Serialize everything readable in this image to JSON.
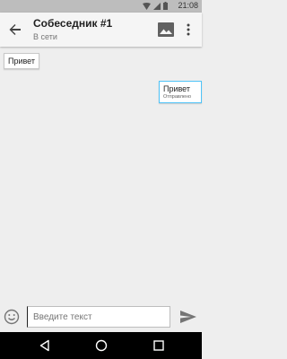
{
  "status_bar": {
    "time": "21:08"
  },
  "header": {
    "title": "Собеседник #1",
    "subtitle": "В сети"
  },
  "messages": [
    {
      "direction": "incoming",
      "text": "Привет"
    },
    {
      "direction": "outgoing",
      "text": "Привет",
      "status": "Отправлено"
    }
  ],
  "composer": {
    "placeholder": "Введите текст",
    "value": ""
  },
  "icons": {
    "back": "arrow-back-icon",
    "image": "image-icon",
    "menu": "more-vert-icon",
    "emoji": "emoji-icon",
    "send": "send-icon"
  },
  "colors": {
    "outgoing_bubble_border": "#4fc3f7",
    "toolbar_background": "#f5f5f5",
    "chat_background": "#eeeeee"
  }
}
